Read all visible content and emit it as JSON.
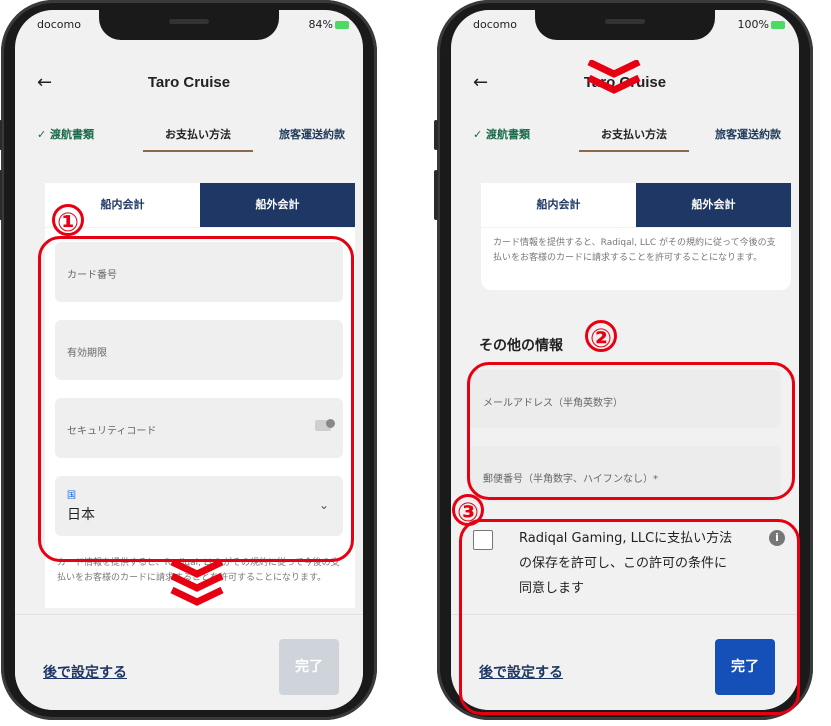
{
  "left": {
    "status": {
      "carrier": "docomo",
      "battery": "84%"
    },
    "title": "Taro Cruise",
    "steps": {
      "done": "✓ 渡航書類",
      "active": "お支払い方法",
      "next": "旅客運送約款"
    },
    "toggle": {
      "onboard": "船内会計",
      "offboard": "船外会計"
    },
    "fields": {
      "card_number": "カード番号",
      "expiry": "有効期限",
      "security_code": "セキュリティコード",
      "country_label": "国",
      "country_value": "日本"
    },
    "consent": "カード情報を提供すると、Radiqal, LLC がその規約に従って今後の支払いをお客様のカードに請求することを許可することになります。",
    "later": "後で設定する",
    "done": "完了"
  },
  "right": {
    "status": {
      "carrier": "docomo",
      "battery": "100%"
    },
    "title": "Taro Cruise",
    "steps": {
      "done": "✓ 渡航書類",
      "active": "お支払い方法",
      "next": "旅客運送約款"
    },
    "toggle": {
      "onboard": "船内会計",
      "offboard": "船外会計"
    },
    "consent": "カード情報を提供すると、Radiqal, LLC がその規約に従って今後の支払いをお客様のカードに請求することを許可することになります。",
    "section_title": "その他の情報",
    "fields": {
      "email": "メールアドレス（半角英数字）",
      "postal": "郵便番号（半角数字、ハイフンなし）*"
    },
    "checkbox_text": "Radiqal Gaming, LLCに支払い方法の保存を許可し、この許可の条件に同意します",
    "later": "後で設定する",
    "done": "完了"
  },
  "annotations": {
    "one": "①",
    "two": "②",
    "three": "③"
  },
  "colors": {
    "accent_red": "#e60012",
    "navy": "#1e3764",
    "done_blue": "#1450b8"
  }
}
